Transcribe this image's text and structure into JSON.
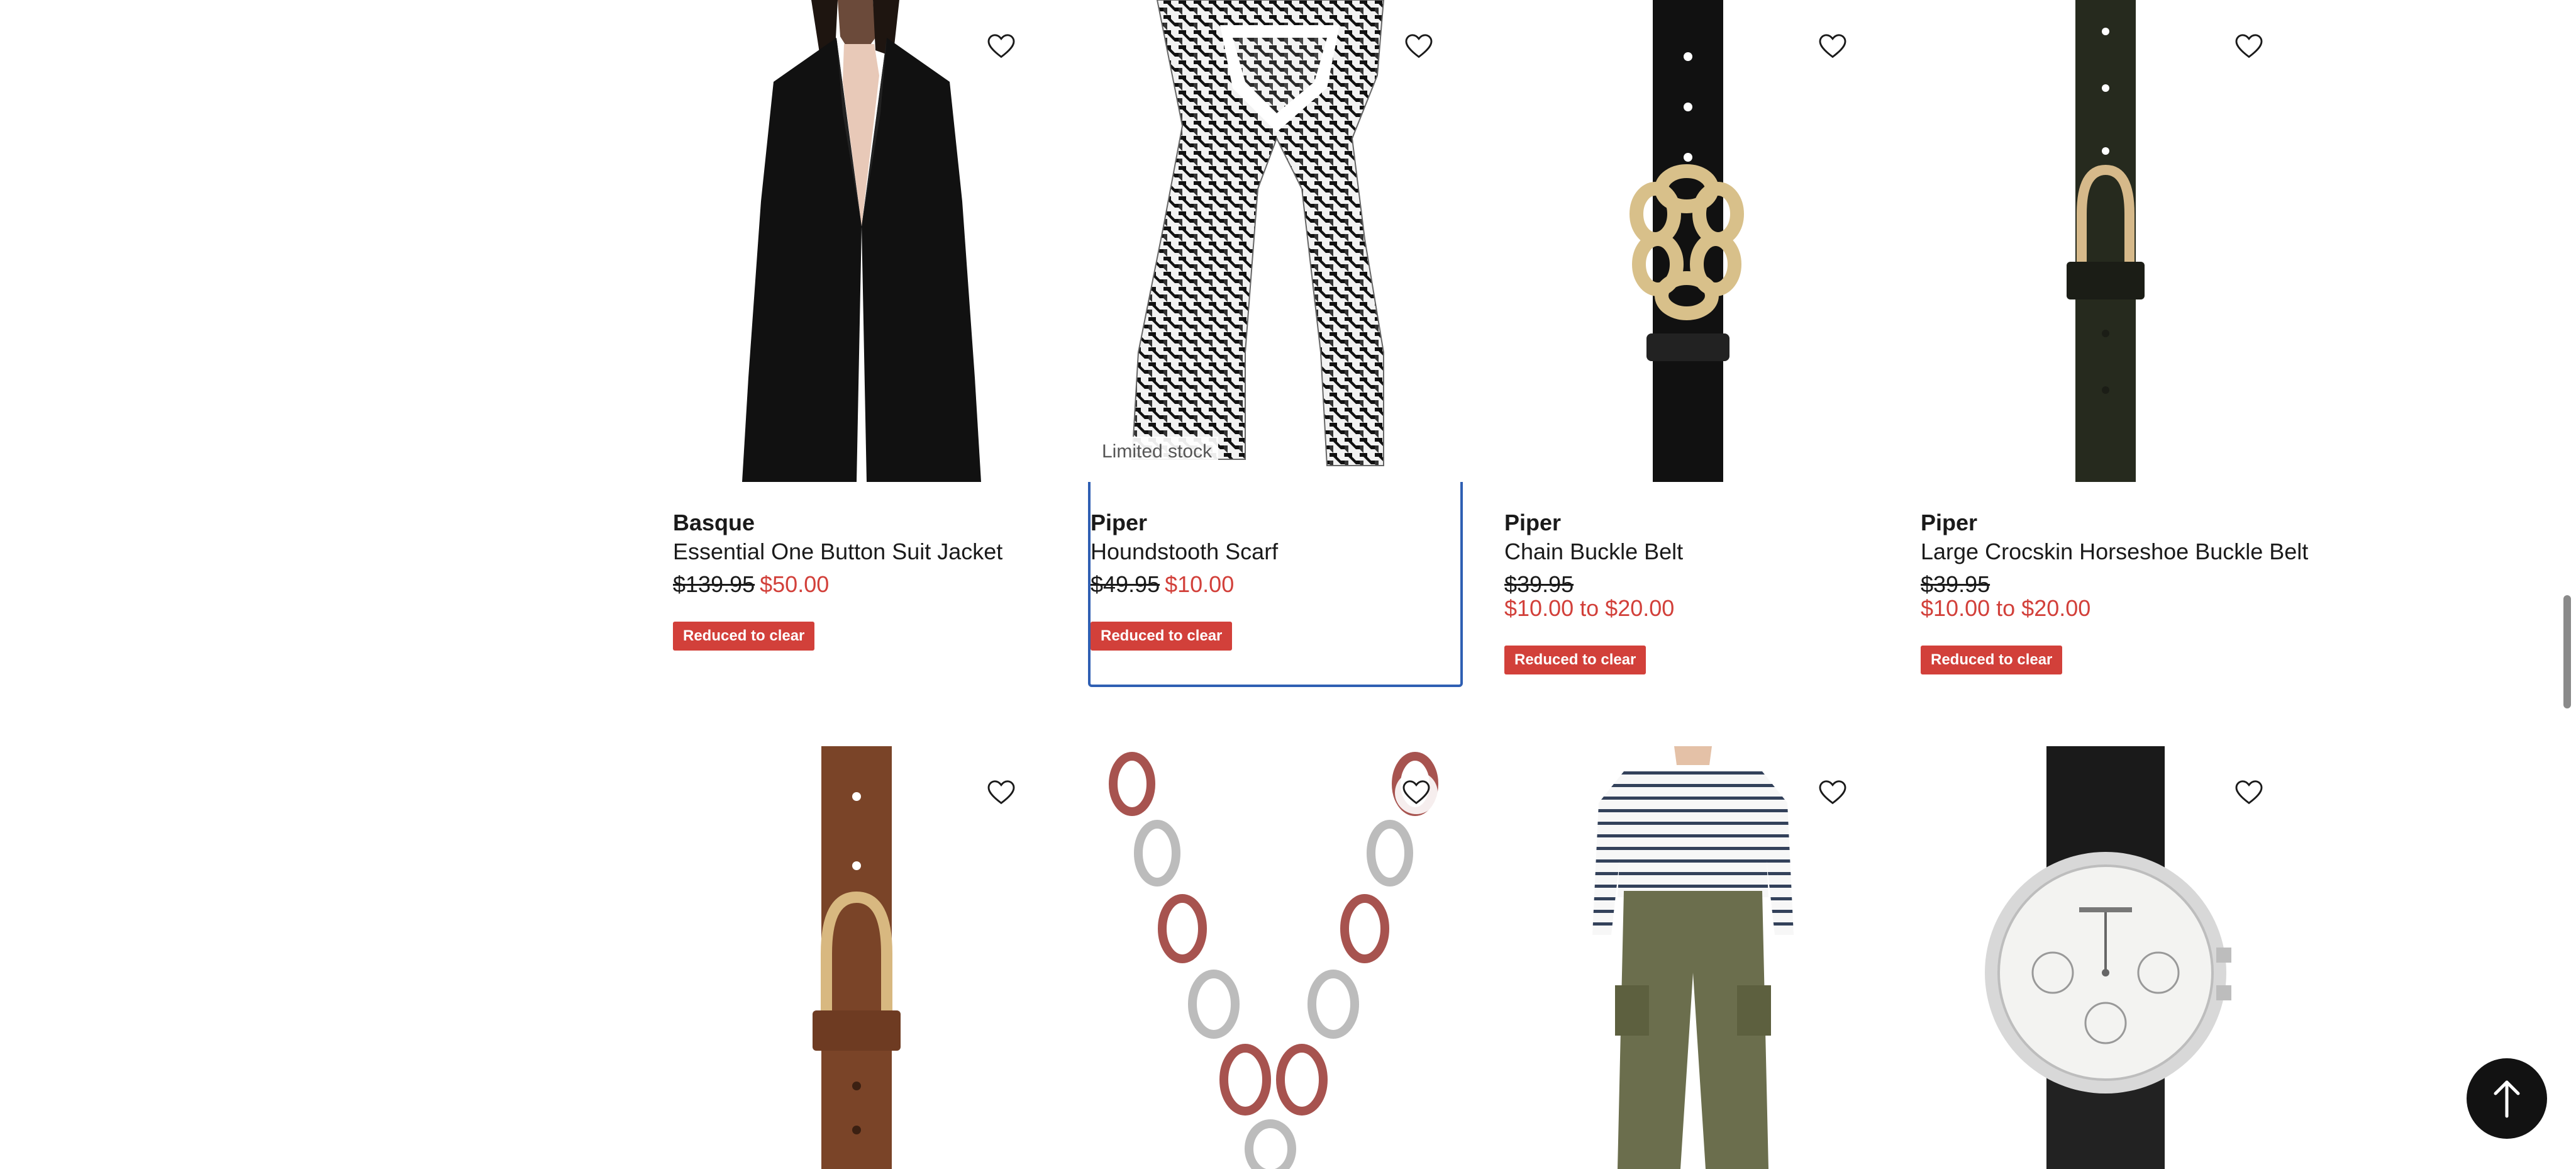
{
  "products": [
    {
      "brand": "Basque",
      "name": "Essential One Button Suit Jacket",
      "was": "$139.95",
      "now": "$50.00",
      "badge": "Reduced to clear",
      "image": "black suit jacket on model"
    },
    {
      "brand": "Piper",
      "name": "Houndstooth Scarf",
      "was": "$49.95",
      "now": "$10.00",
      "badge": "Reduced to clear",
      "tag": "Limited stock",
      "image": "houndstooth scarf"
    },
    {
      "brand": "Piper",
      "name": "Chain Buckle Belt",
      "was": "$39.95",
      "now_from": "$10.00",
      "to_word": "to",
      "now_to": "$20.00",
      "badge": "Reduced to clear",
      "image": "black belt with gold chain buckle"
    },
    {
      "brand": "Piper",
      "name": "Large Crocskin Horseshoe Buckle Belt",
      "was": "$39.95",
      "now_from": "$10.00",
      "to_word": "to",
      "now_to": "$20.00",
      "badge": "Reduced to clear",
      "image": "dark green crocskin belt"
    },
    {
      "image": "brown leather belt"
    },
    {
      "image": "chain link necklace"
    },
    {
      "image": "striped top and khaki cargo pants"
    },
    {
      "image": "silver chronograph watch with black strap"
    }
  ],
  "colors": {
    "sale": "#d2403a",
    "focus": "#2f5fb3",
    "text": "#1a1a1a"
  },
  "icons": {
    "wishlist": "heart-outline-icon",
    "back_to_top": "arrow-up-icon"
  }
}
